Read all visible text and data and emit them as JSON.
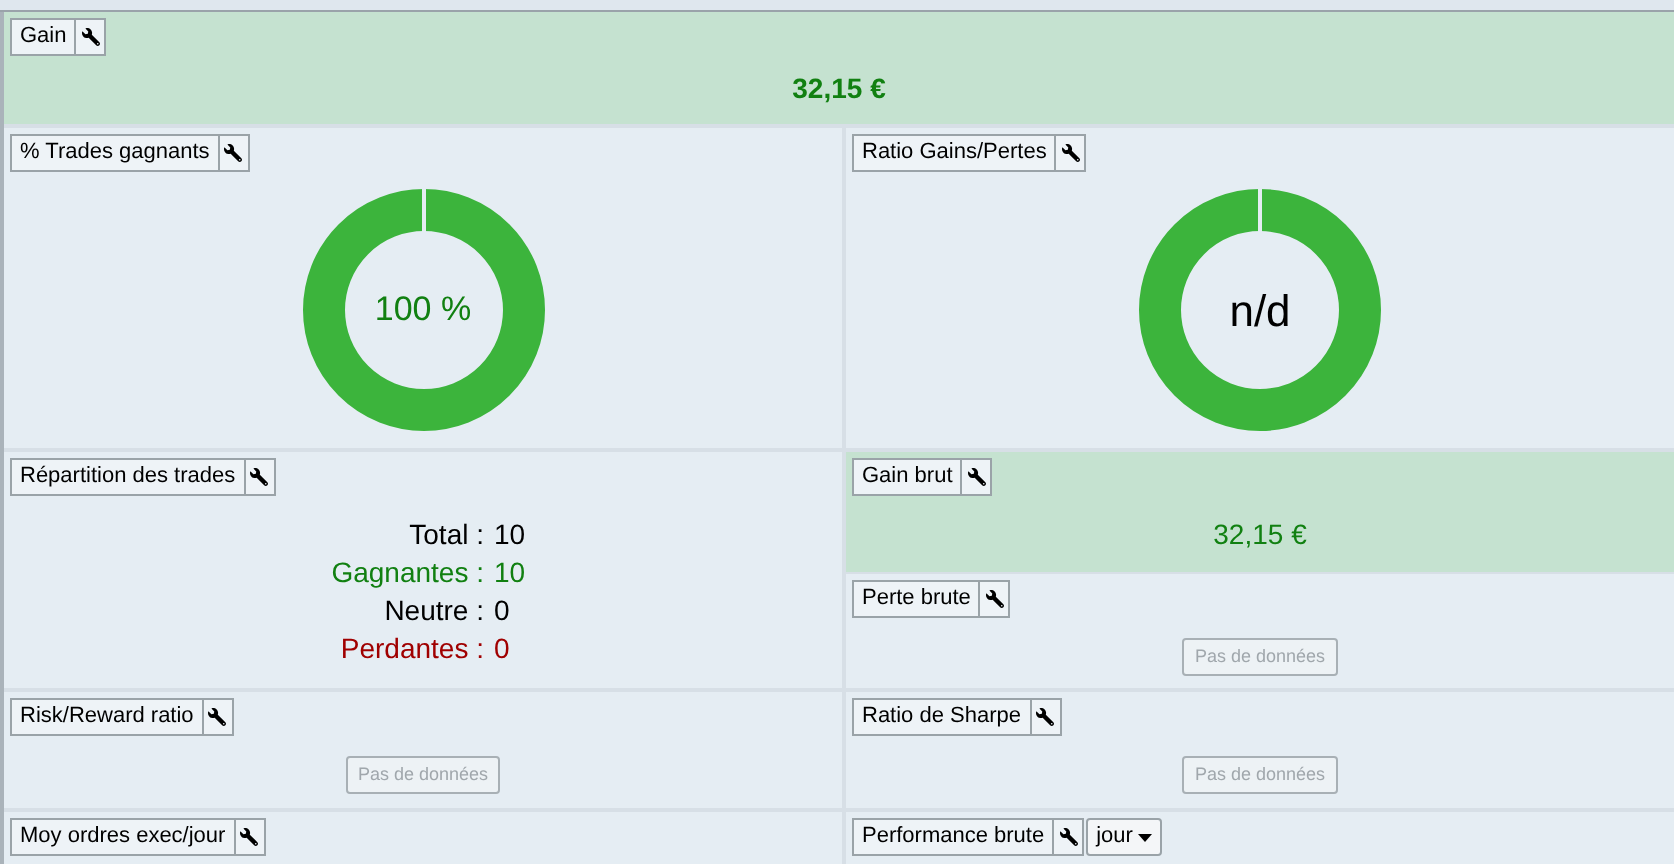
{
  "gain": {
    "title": "Gain",
    "value": "32,15 €",
    "highlighted": true
  },
  "win_rate": {
    "title": "% Trades gagnants",
    "center": "100 %",
    "kind": "positive"
  },
  "ratio": {
    "title": "Ratio Gains/Pertes",
    "center": "n/d",
    "kind": "neutral"
  },
  "breakdown": {
    "title": "Répartition des trades",
    "items": [
      {
        "label": "Total :",
        "value": "10",
        "color": "#000000"
      },
      {
        "label": "Gagnantes :",
        "value": "10",
        "color": "#118011"
      },
      {
        "label": "Neutre :",
        "value": "0",
        "color": "#000000"
      },
      {
        "label": "Perdantes :",
        "value": "0",
        "color": "#a00000"
      }
    ]
  },
  "gross_gain": {
    "title": "Gain brut",
    "value": "32,15 €",
    "highlighted": true
  },
  "gross_loss": {
    "title": "Perte brute",
    "empty_label": "Pas de données"
  },
  "risk_reward": {
    "title": "Risk/Reward ratio",
    "empty_label": "Pas de données"
  },
  "sharpe": {
    "title": "Ratio de Sharpe",
    "empty_label": "Pas de données"
  },
  "avg_orders": {
    "title": "Moy ordres exec/jour"
  },
  "performance": {
    "title": "Performance brute",
    "period": "jour"
  }
}
